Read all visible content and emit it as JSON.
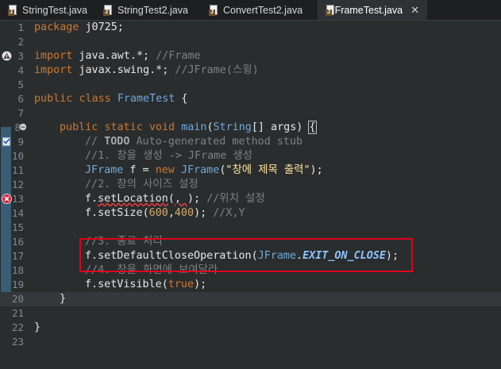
{
  "tabs": [
    {
      "label": "StringTest.java",
      "active": false
    },
    {
      "label": "StringTest2.java",
      "active": false
    },
    {
      "label": "ConvertTest2.java",
      "active": false
    },
    {
      "label": "*FrameTest.java",
      "active": true
    }
  ],
  "tab_close_glyph": "✕",
  "line_numbers": [
    "1",
    "2",
    "3",
    "4",
    "5",
    "6",
    "7",
    "8",
    "9",
    "10",
    "11",
    "12",
    "13",
    "14",
    "15",
    "16",
    "17",
    "18",
    "19",
    "20",
    "21",
    "22",
    "23"
  ],
  "markers": {
    "line3": "warning-icon",
    "line8": "fold-collapse-icon",
    "line9": "task-icon",
    "line13": "error-icon"
  },
  "code": {
    "l1": [
      "package",
      " j0725;"
    ],
    "l3": [
      "import",
      " java.awt.*; ",
      "//Frame"
    ],
    "l4": [
      "import",
      " javax.swing.*; ",
      "//JFrame(스윙)"
    ],
    "l6": [
      "public",
      " ",
      "class",
      " ",
      "FrameTest",
      " {"
    ],
    "l8": [
      "public",
      " ",
      "static",
      " ",
      "void",
      " ",
      "main",
      "(",
      "String",
      "[] args) ",
      "{"
    ],
    "l9": [
      "// ",
      "TODO",
      " Auto-generated method stub"
    ],
    "l10": "//1. 창을 생성 -> JFrame 생성",
    "l11": [
      "JFrame",
      " f = ",
      "new",
      " ",
      "JFrame",
      "(",
      "\"창에 제목 출력\"",
      ");"
    ],
    "l12": "//2. 창의 사이즈 설정",
    "l13": [
      "f.",
      "setLocation",
      "(",
      ", ",
      "); ",
      "//위치 설정"
    ],
    "l14": [
      "f.",
      "setSize",
      "(",
      "600",
      ",",
      "400",
      "); ",
      "//X,Y"
    ],
    "l16": "//3. 종료 처리",
    "l17": [
      "f.",
      "setDefaultCloseOperation",
      "(",
      "JFrame",
      ".",
      "EXIT_ON_CLOSE",
      ");"
    ],
    "l18": "//4. 창을 화면에 보여달라",
    "l19": [
      "f.",
      "setVisible",
      "(",
      "true",
      ");"
    ],
    "l20": "}",
    "l22": "}"
  },
  "colors": {
    "highlight_box": "#e0001b",
    "editor_bg": "#2a2d2e"
  }
}
